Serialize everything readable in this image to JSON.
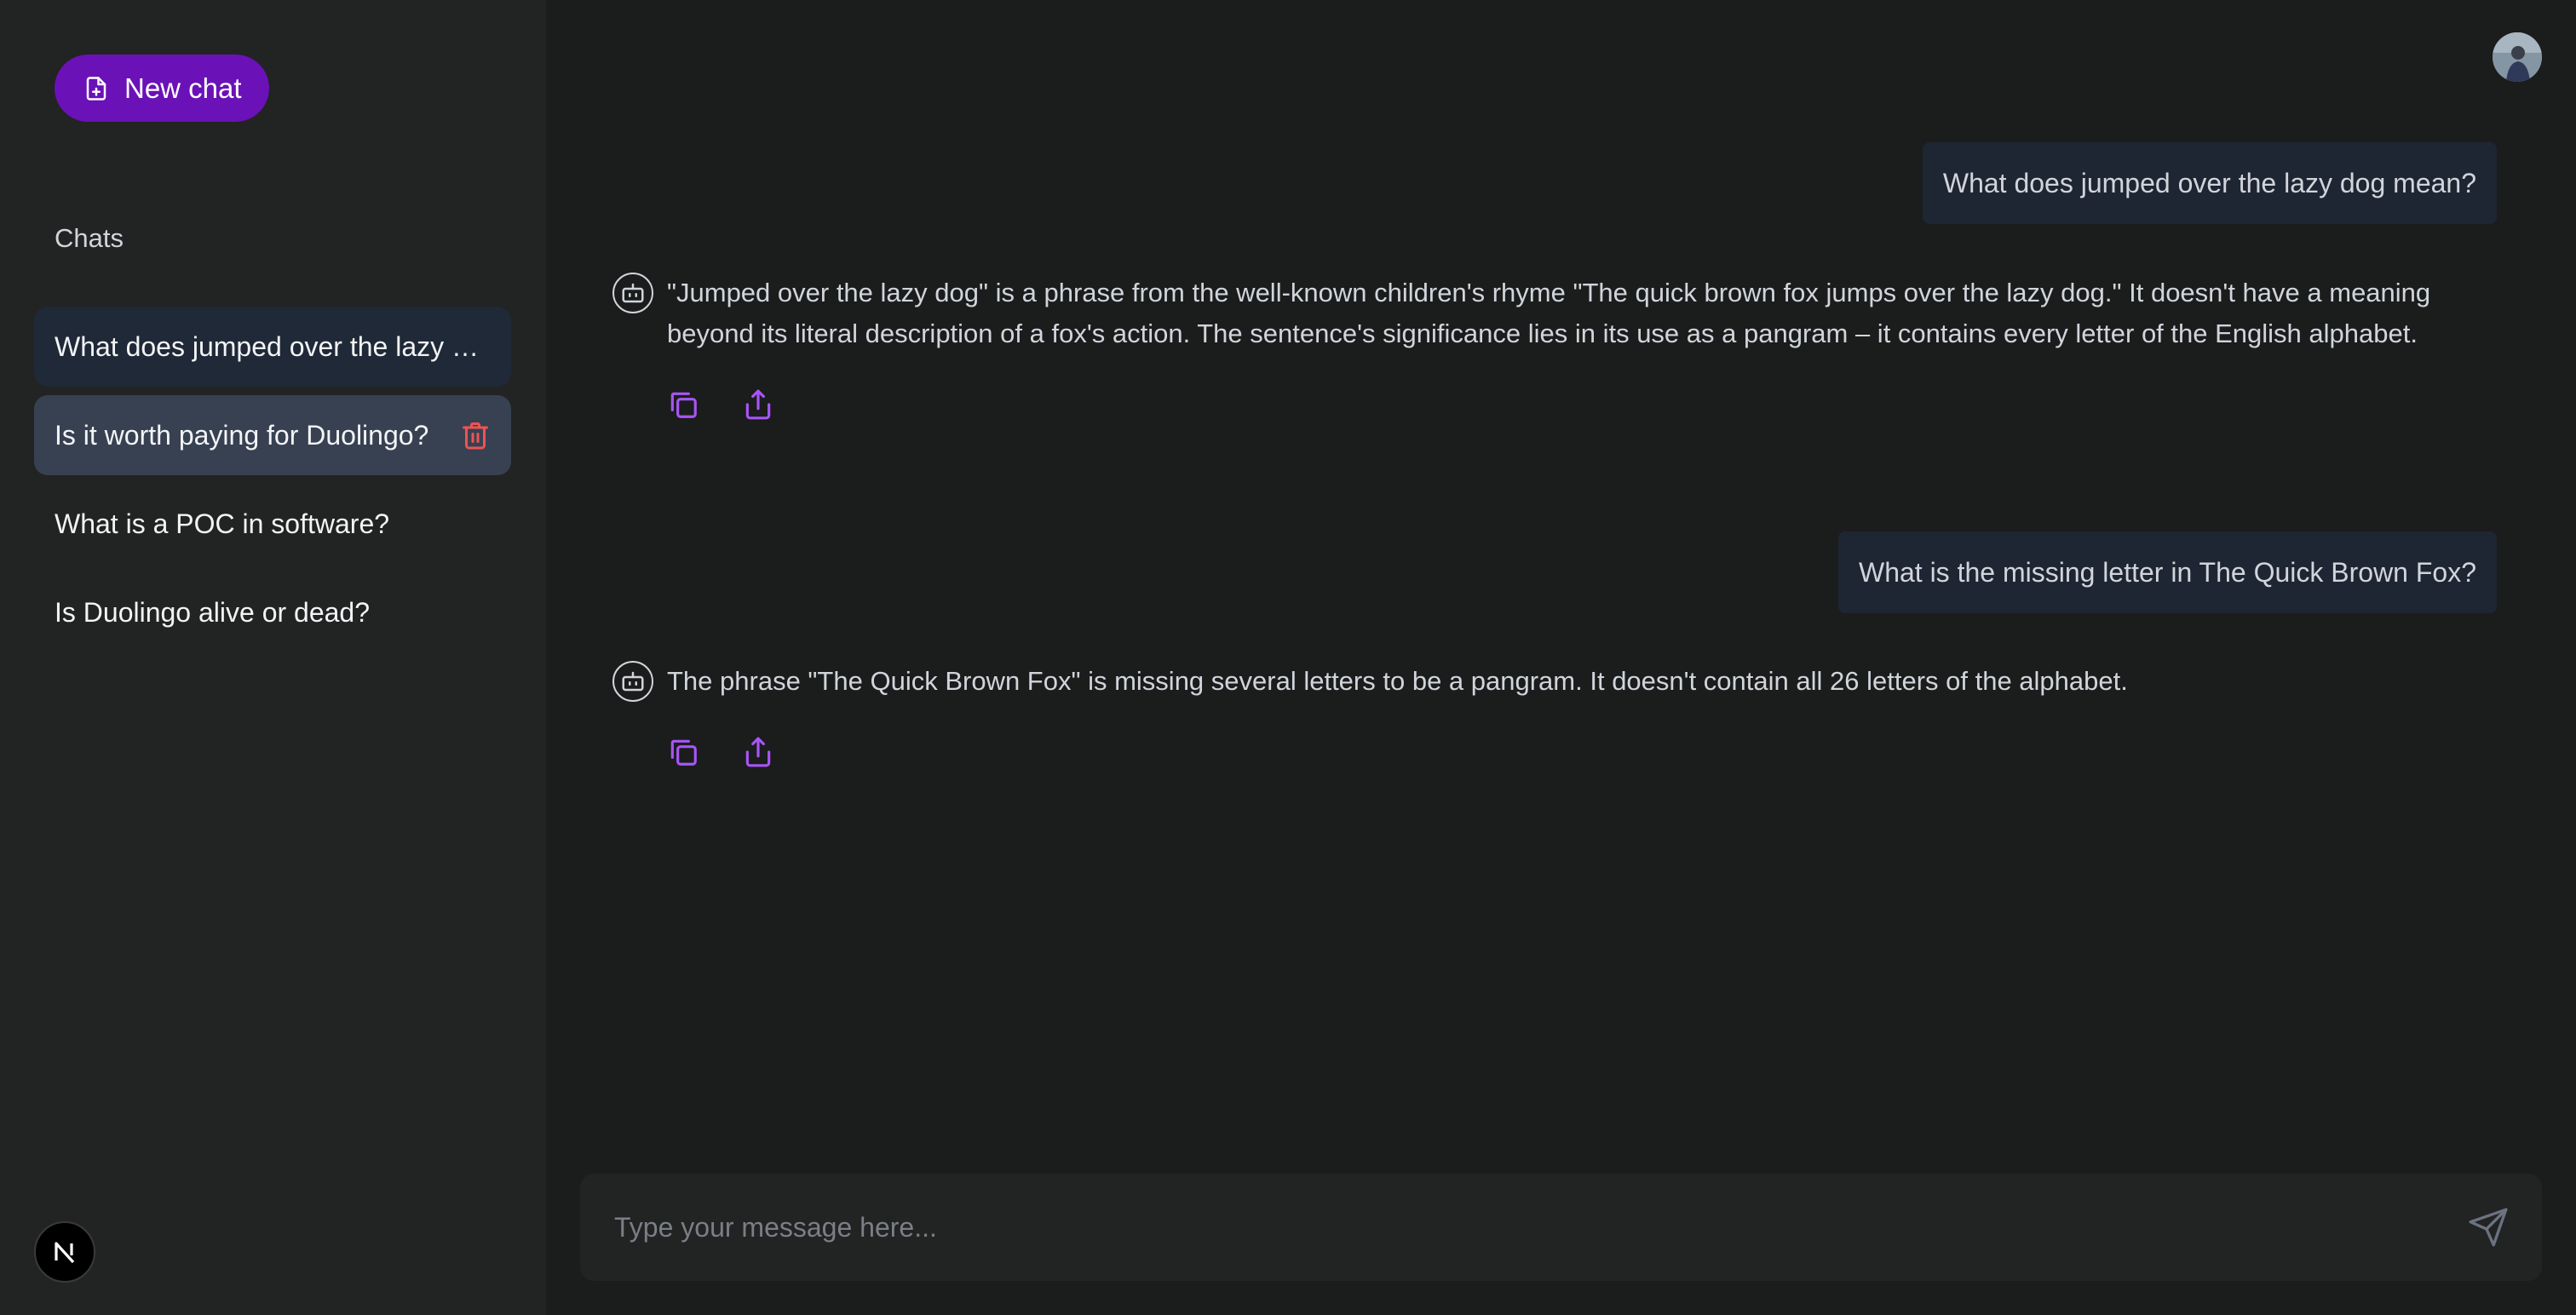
{
  "sidebar": {
    "new_chat_label": "New chat",
    "chats_heading": "Chats",
    "items": [
      {
        "label": "What does jumped over the lazy dog mean?",
        "state": "active"
      },
      {
        "label": "Is it worth paying for Duolingo?",
        "state": "hover"
      },
      {
        "label": "What is a POC in software?",
        "state": "normal"
      },
      {
        "label": "Is Duolingo alive or dead?",
        "state": "normal"
      }
    ],
    "footer_logo": "N"
  },
  "conversation": {
    "messages": [
      {
        "role": "user",
        "text": "What does jumped over the lazy dog mean?"
      },
      {
        "role": "assistant",
        "text": "\"Jumped over the lazy dog\" is a phrase from the well-known children's rhyme \"The quick brown fox jumps over the lazy dog.\" It doesn't have a meaning beyond its literal description of a fox's action. The sentence's significance lies in its use as a pangram – it contains every letter of the English alphabet."
      },
      {
        "role": "user",
        "text": "What is the missing letter in The Quick Brown Fox?"
      },
      {
        "role": "assistant",
        "text": "The phrase \"The Quick Brown Fox\" is missing several letters to be a pangram. It doesn't contain all 26 letters of the alphabet."
      }
    ]
  },
  "composer": {
    "placeholder": "Type your message here...",
    "value": ""
  },
  "colors": {
    "accent": "#6b11b8",
    "icon_accent": "#a855f7",
    "delete": "#f05252",
    "background": "#1b1c1c",
    "sidebar": "#222323",
    "user_bubble": "#1e2633"
  },
  "icons": {
    "new_chat": "file-plus-icon",
    "delete": "trash-icon",
    "assistant": "robot-icon",
    "copy": "copy-icon",
    "share": "share-icon",
    "send": "send-icon"
  }
}
